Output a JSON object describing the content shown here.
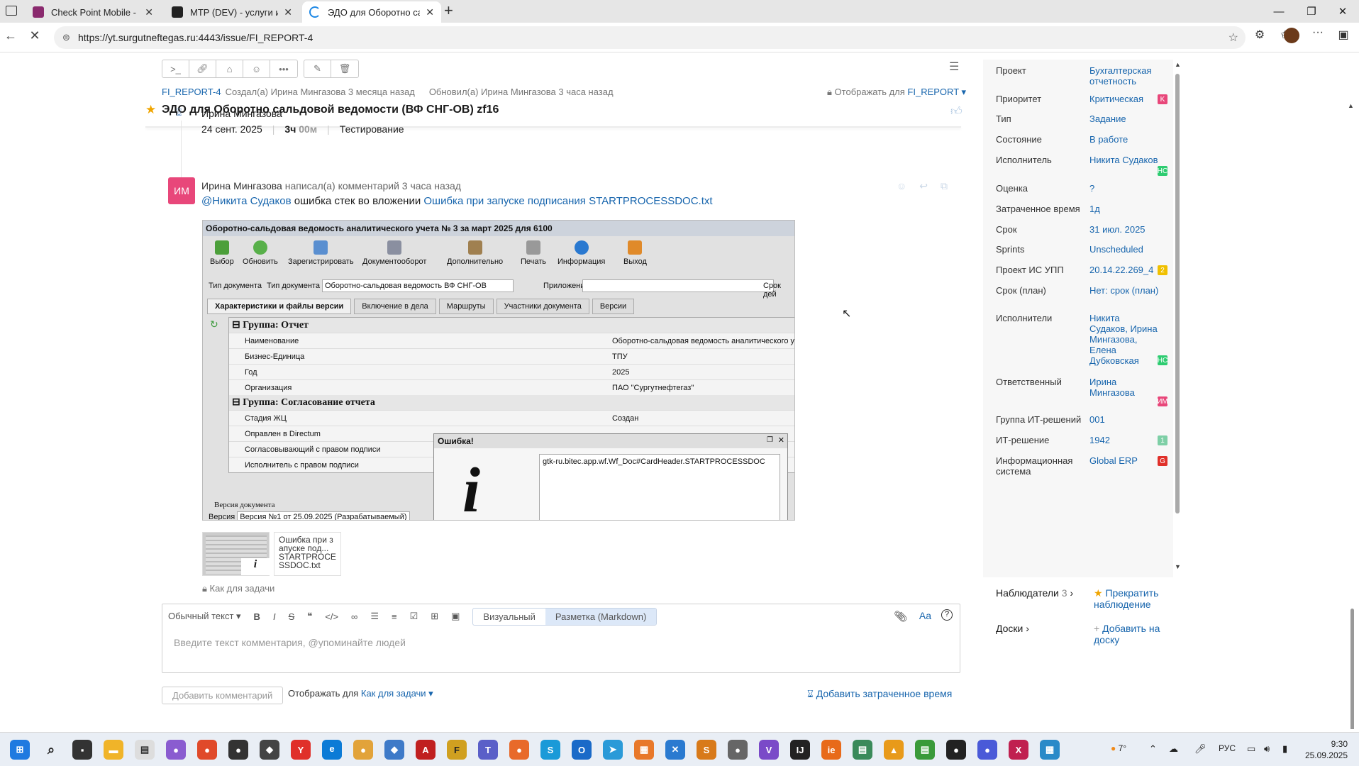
{
  "browser": {
    "tabs": [
      {
        "title": "Check Point Mobile - Регистраци",
        "color": "#8a2a6e"
      },
      {
        "title": "MTP (DEV) - услуги и спецодеж",
        "color": "#222222"
      },
      {
        "title": "ЭДО для Оборотно сальдовой в",
        "color": "#1e88e5"
      }
    ],
    "url": "https://yt.surgutneftegas.ru:4443/issue/FI_REPORT-4"
  },
  "issue": {
    "id": "FI_REPORT-4",
    "created": "Создал(а) Ирина Мингазова 3 месяца назад",
    "updated": "Обновил(а) Ирина Мингазова 3 часа назад",
    "visibility_label": "Отображать для",
    "visibility_value": "FI_REPORT",
    "title": "ЭДО для Оборотно сальдовой ведомости (ВФ СНГ-ОВ) zf16"
  },
  "worklog": {
    "author": "Ирина Мингазова",
    "date": "24 сент. 2025",
    "hours": "3ч",
    "minutes": "00м",
    "type": "Тестирование"
  },
  "comment": {
    "avatar": "ИМ",
    "author": "Ирина Мингазова",
    "action": "написал(а) комментарий 3 часа назад",
    "mention": "@Никита Судаков",
    "text": "ошибка стек во вложении",
    "link": "Ошибка при запуске подписания STARTPROCESSDOC.txt",
    "attachment_label": "Ошибка при з апуске под... STARTPROCE SSDOC.txt",
    "visibility": "Как для задачи"
  },
  "screenshot": {
    "title": "Оборотно-сальдовая ведомость аналитического учета № 3 за март 2025 для 6100",
    "tools": [
      "Выбор",
      "Обновить",
      "Зарегистрировать",
      "Документооборот",
      "Дополнительно",
      "Печать",
      "Информация",
      "Выход"
    ],
    "doc_type_label": "Тип документа",
    "doc_type_label2": "Тип документа",
    "doc_type_value": "Оборотно-сальдовая ведомость ВФ СНГ-ОВ",
    "attach_label": "Приложение",
    "due_label": "Срок дей",
    "tabs": [
      "Характеристики и файлы версии",
      "Включение в дела",
      "Маршруты",
      "Участники документа",
      "Версии"
    ],
    "group1": "Группа: Отчет",
    "rows1": [
      [
        "Наименование",
        "Оборотно-сальдовая ведомость аналитического у"
      ],
      [
        "Бизнес-Единица",
        "ТПУ"
      ],
      [
        "Год",
        "2025"
      ],
      [
        "Организация",
        "ПАО \"Сургутнефтегаз\""
      ]
    ],
    "group2": "Группа: Согласование отчета",
    "rows2": [
      [
        "Стадия ЖЦ",
        "Создан"
      ],
      [
        "Оправлен в Directum",
        ""
      ],
      [
        "Согласовывающий с правом подписи",
        ""
      ],
      [
        "Исполнитель с правом подписи",
        ""
      ]
    ],
    "version_label": "Версия документа",
    "version_row": "Версия №1 от 25.09.2025 (Разрабатываемый)",
    "dialog_title": "Ошибка!",
    "dialog_msg": "gtk-ru.bitec.app.wf.Wf_Doc#CardHeader.STARTPROCESSDOC"
  },
  "editor": {
    "style": "Обычный текст",
    "visual": "Визуальный",
    "markdown": "Разметка (Markdown)",
    "placeholder": "Введите текст комментария, @упоминайте людей",
    "add": "Добавить комментарий",
    "show_for": "Отображать для",
    "show_for_value": "Как для задачи",
    "add_time": "Добавить затраченное время"
  },
  "fields": [
    {
      "k": "Проект",
      "v": "Бухгалтерская отчетность"
    },
    {
      "k": "Приоритет",
      "v": "Критическая",
      "badge": "K",
      "bc": "#e8477a"
    },
    {
      "k": "Тип",
      "v": "Задание"
    },
    {
      "k": "Состояние",
      "v": "В работе"
    },
    {
      "k": "Исполнитель",
      "v": "Никита Судаков",
      "badge": "HC",
      "bc": "#2ecc71"
    },
    {
      "k": "Оценка",
      "v": "?"
    },
    {
      "k": "Затраченное время",
      "v": "1д"
    },
    {
      "k": "Срок",
      "v": "31 июл. 2025"
    },
    {
      "k": "Sprints",
      "v": "Unscheduled"
    },
    {
      "k": "Проект ИС УПП",
      "v": "20.14.22.269_4",
      "badge": "2",
      "bc": "#f0c000"
    },
    {
      "k": "Срок (план)",
      "v": "Нет: срок (план)"
    },
    {
      "k": "Исполнители",
      "v": "Никита Судаков, Ирина Мингазова, Елена Дубковская",
      "badge": "HC",
      "bc": "#2ecc71"
    },
    {
      "k": "Ответственный",
      "v": "Ирина Мингазова",
      "badge": "ИМ",
      "bc": "#e8477a"
    },
    {
      "k": "Группа ИТ-решений",
      "v": "001"
    },
    {
      "k": "ИТ-решение",
      "v": "1942",
      "badge": "1",
      "bc": "#7ecfa6"
    },
    {
      "k": "Информационная система",
      "v": "Global ERP",
      "badge": "G",
      "bc": "#e0302a"
    }
  ],
  "watchers": {
    "label": "Наблюдатели",
    "count": "3",
    "action": "Прекратить наблюдение"
  },
  "boards": {
    "label": "Доски",
    "action": "Добавить на доску"
  },
  "tray": {
    "lang": "РУС",
    "time": "9:30",
    "date": "25.09.2025",
    "weather": "7°"
  }
}
